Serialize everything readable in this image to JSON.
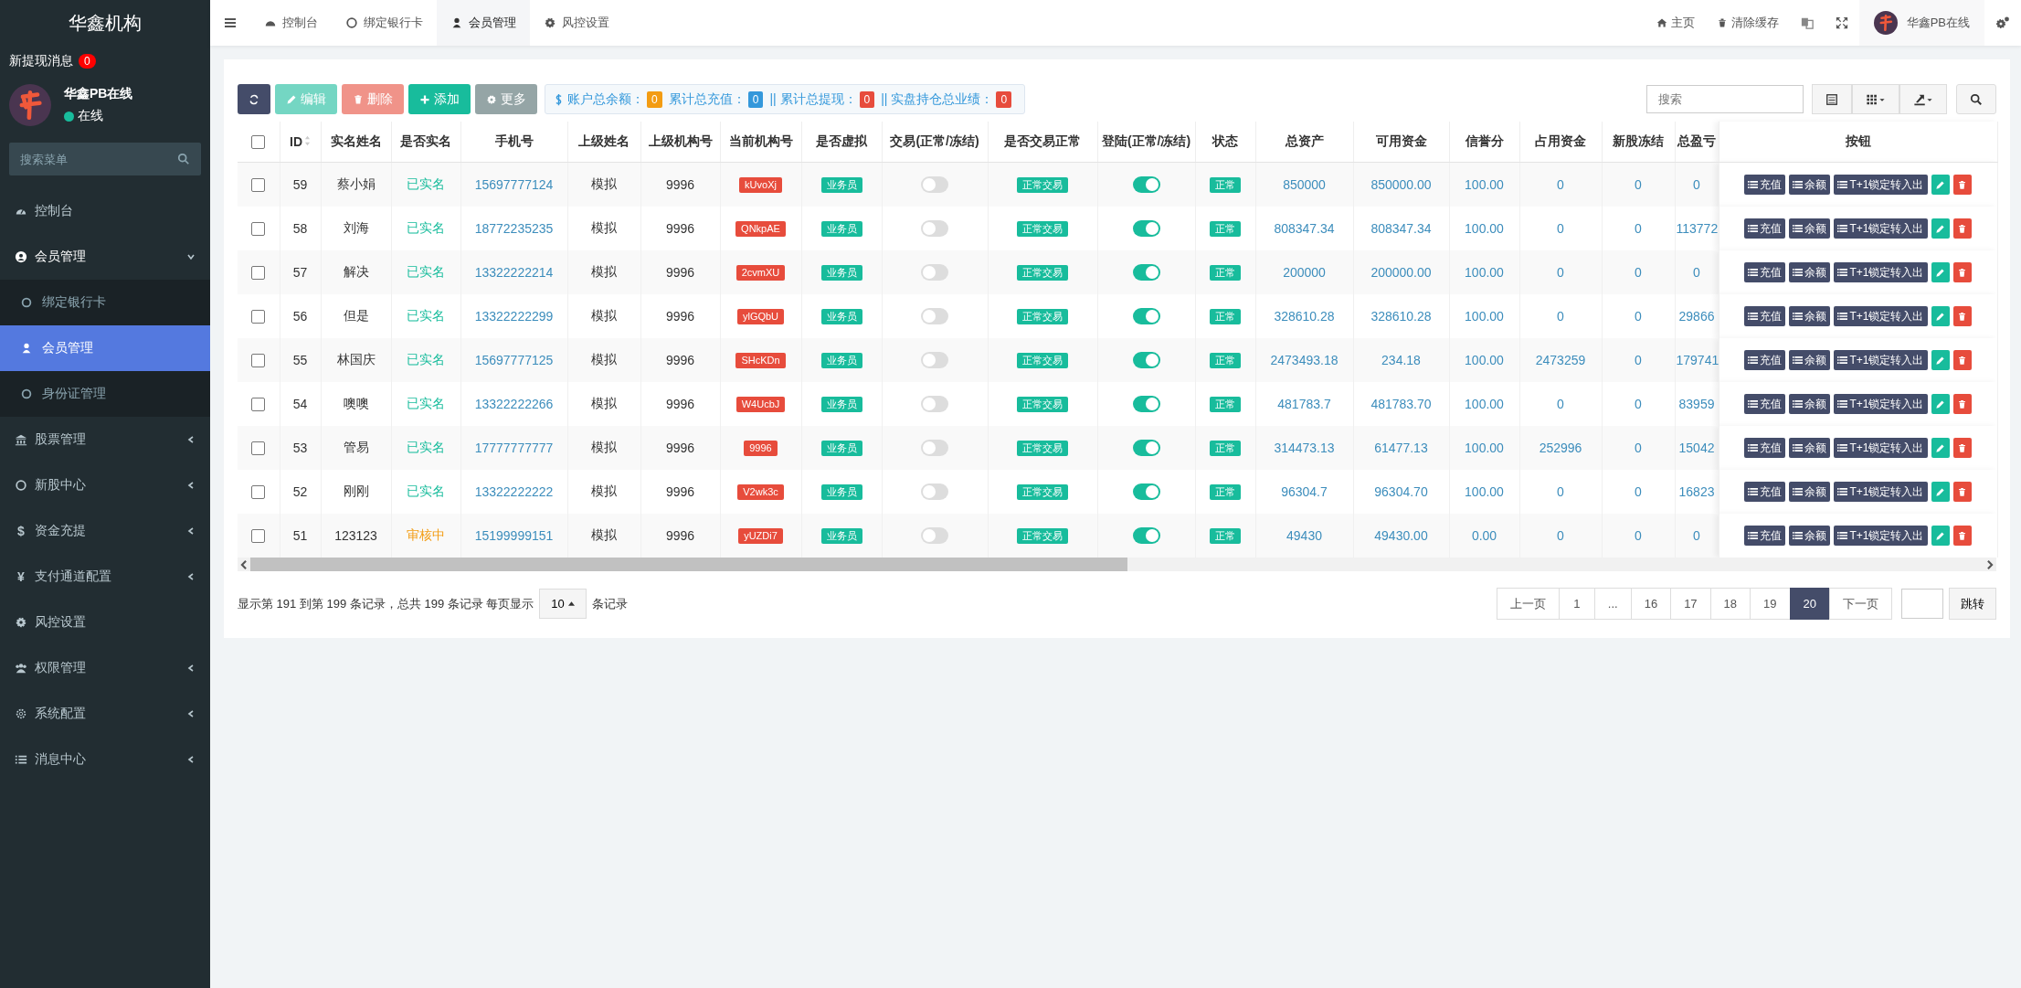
{
  "sidebar": {
    "brand": "华鑫机构",
    "notice": {
      "label": "新提现消息",
      "count": "0"
    },
    "user": {
      "name": "华鑫PB在线",
      "status": "在线",
      "online": true
    },
    "search": {
      "placeholder": "搜索菜单"
    },
    "items": [
      {
        "label": "控制台",
        "selected": false
      },
      {
        "label": "会员管理",
        "selected": false,
        "expanded": true,
        "children": [
          {
            "label": "绑定银行卡",
            "selected": false
          },
          {
            "label": "会员管理",
            "selected": true
          },
          {
            "label": "身份证管理",
            "selected": false
          }
        ]
      },
      {
        "label": "股票管理",
        "selected": false,
        "expanded": false
      },
      {
        "label": "新股中心",
        "selected": false,
        "expanded": false
      },
      {
        "label": "资金充提",
        "selected": false,
        "expanded": false,
        "glyph": "$"
      },
      {
        "label": "支付通道配置",
        "selected": false,
        "expanded": false,
        "glyph": "¥"
      },
      {
        "label": "风控设置",
        "selected": false
      },
      {
        "label": "权限管理",
        "selected": false,
        "expanded": false
      },
      {
        "label": "系统配置",
        "selected": false,
        "expanded": false
      },
      {
        "label": "消息中心",
        "selected": false,
        "expanded": false
      }
    ]
  },
  "topbar": {
    "tabs": [
      {
        "label": "控制台",
        "selected": false
      },
      {
        "label": "绑定银行卡",
        "selected": false
      },
      {
        "label": "会员管理",
        "selected": true
      },
      {
        "label": "风控设置",
        "selected": false
      }
    ],
    "links": [
      "主页",
      "清除缓存"
    ],
    "user": "华鑫PB在线"
  },
  "toolbar": {
    "buttons": [
      {
        "kind": "refresh",
        "disabled": false
      },
      {
        "kind": "edit",
        "label": "编辑",
        "disabled": true
      },
      {
        "kind": "delete",
        "label": "删除",
        "disabled": true
      },
      {
        "kind": "add",
        "label": "添加",
        "disabled": false
      },
      {
        "kind": "more",
        "label": "更多",
        "disabled": false
      }
    ],
    "stats": [
      {
        "label": "账户总余额：",
        "value": "0",
        "color": "#f39c12"
      },
      {
        "label": "累计总充值：",
        "value": "0",
        "color": "#3498db"
      },
      {
        "label": "|| 累计总提现：",
        "value": "0",
        "color": "#e74c3c"
      },
      {
        "label": "|| 实盘持仓总业绩：",
        "value": "0",
        "color": "#e74c3c"
      }
    ],
    "search": {
      "placeholder": "搜索"
    }
  },
  "table": {
    "select_all": false,
    "columns": [
      "ID",
      "实名姓名",
      "是否实名",
      "手机号",
      "上级姓名",
      "上级机构号",
      "当前机构号",
      "是否虚拟",
      "交易(正常/冻结)",
      "是否交易正常",
      "登陆(正常/冻结)",
      "状态",
      "总资产",
      "可用资金",
      "信誉分",
      "占用资金",
      "新股冻结",
      "总盈亏",
      "按钮"
    ],
    "rows": [
      {
        "checked": false,
        "id": "59",
        "name": "蔡小娟",
        "verify": {
          "text": "已实名",
          "kind": "done"
        },
        "phone": "15697777124",
        "parent": "模拟",
        "parent_org": "9996",
        "org": "kUvoXj",
        "virtual": "业务员",
        "trade_on": false,
        "trade_status": "正常交易",
        "login_on": true,
        "state": "正常",
        "total": "850000",
        "available": "850000.00",
        "credit": "100.00",
        "occupied": "0",
        "ipo_frozen": "0",
        "pnl": "0",
        "actions": [
          "充值",
          "余额",
          "T+1锁定转入出"
        ]
      },
      {
        "checked": false,
        "id": "58",
        "name": "刘海",
        "verify": {
          "text": "已实名",
          "kind": "done"
        },
        "phone": "18772235235",
        "parent": "模拟",
        "parent_org": "9996",
        "org": "QNkpAE",
        "virtual": "业务员",
        "trade_on": false,
        "trade_status": "正常交易",
        "login_on": true,
        "state": "正常",
        "total": "808347.34",
        "available": "808347.34",
        "credit": "100.00",
        "occupied": "0",
        "ipo_frozen": "0",
        "pnl": "113772",
        "actions": [
          "充值",
          "余额",
          "T+1锁定转入出"
        ]
      },
      {
        "checked": false,
        "id": "57",
        "name": "解决",
        "verify": {
          "text": "已实名",
          "kind": "done"
        },
        "phone": "13322222214",
        "parent": "模拟",
        "parent_org": "9996",
        "org": "2cvmXU",
        "virtual": "业务员",
        "trade_on": false,
        "trade_status": "正常交易",
        "login_on": true,
        "state": "正常",
        "total": "200000",
        "available": "200000.00",
        "credit": "100.00",
        "occupied": "0",
        "ipo_frozen": "0",
        "pnl": "0",
        "actions": [
          "充值",
          "余额",
          "T+1锁定转入出"
        ]
      },
      {
        "checked": false,
        "id": "56",
        "name": "但是",
        "verify": {
          "text": "已实名",
          "kind": "done"
        },
        "phone": "13322222299",
        "parent": "模拟",
        "parent_org": "9996",
        "org": "ylGQbU",
        "virtual": "业务员",
        "trade_on": false,
        "trade_status": "正常交易",
        "login_on": true,
        "state": "正常",
        "total": "328610.28",
        "available": "328610.28",
        "credit": "100.00",
        "occupied": "0",
        "ipo_frozen": "0",
        "pnl": "29866",
        "actions": [
          "充值",
          "余额",
          "T+1锁定转入出"
        ]
      },
      {
        "checked": false,
        "id": "55",
        "name": "林国庆",
        "verify": {
          "text": "已实名",
          "kind": "done"
        },
        "phone": "15697777125",
        "parent": "模拟",
        "parent_org": "9996",
        "org": "SHcKDn",
        "virtual": "业务员",
        "trade_on": false,
        "trade_status": "正常交易",
        "login_on": true,
        "state": "正常",
        "total": "2473493.18",
        "available": "234.18",
        "credit": "100.00",
        "occupied": "2473259",
        "ipo_frozen": "0",
        "pnl": "179741",
        "actions": [
          "充值",
          "余额",
          "T+1锁定转入出"
        ]
      },
      {
        "checked": false,
        "id": "54",
        "name": "噢噢",
        "verify": {
          "text": "已实名",
          "kind": "done"
        },
        "phone": "13322222266",
        "parent": "模拟",
        "parent_org": "9996",
        "org": "W4UcbJ",
        "virtual": "业务员",
        "trade_on": false,
        "trade_status": "正常交易",
        "login_on": true,
        "state": "正常",
        "total": "481783.7",
        "available": "481783.70",
        "credit": "100.00",
        "occupied": "0",
        "ipo_frozen": "0",
        "pnl": "83959",
        "actions": [
          "充值",
          "余额",
          "T+1锁定转入出"
        ]
      },
      {
        "checked": false,
        "id": "53",
        "name": "管易",
        "verify": {
          "text": "已实名",
          "kind": "done"
        },
        "phone": "17777777777",
        "parent": "模拟",
        "parent_org": "9996",
        "org": "9996",
        "virtual": "业务员",
        "trade_on": false,
        "trade_status": "正常交易",
        "login_on": true,
        "state": "正常",
        "total": "314473.13",
        "available": "61477.13",
        "credit": "100.00",
        "occupied": "252996",
        "ipo_frozen": "0",
        "pnl": "15042",
        "actions": [
          "充值",
          "余额",
          "T+1锁定转入出"
        ]
      },
      {
        "checked": false,
        "id": "52",
        "name": "刚刚",
        "verify": {
          "text": "已实名",
          "kind": "done"
        },
        "phone": "13322222222",
        "parent": "模拟",
        "parent_org": "9996",
        "org": "V2wk3c",
        "virtual": "业务员",
        "trade_on": false,
        "trade_status": "正常交易",
        "login_on": true,
        "state": "正常",
        "total": "96304.7",
        "available": "96304.70",
        "credit": "100.00",
        "occupied": "0",
        "ipo_frozen": "0",
        "pnl": "16823",
        "actions": [
          "充值",
          "余额",
          "T+1锁定转入出"
        ]
      },
      {
        "checked": false,
        "id": "51",
        "name": "123123",
        "verify": {
          "text": "审核中",
          "kind": "pending"
        },
        "phone": "15199999151",
        "parent": "模拟",
        "parent_org": "9996",
        "org": "yUZDi7",
        "virtual": "业务员",
        "trade_on": false,
        "trade_status": "正常交易",
        "login_on": true,
        "state": "正常",
        "total": "49430",
        "available": "49430.00",
        "credit": "0.00",
        "occupied": "0",
        "ipo_frozen": "0",
        "pnl": "0",
        "actions": [
          "充值",
          "余额",
          "T+1锁定转入出"
        ]
      }
    ]
  },
  "pagination": {
    "info": "显示第 191 到第 199 条记录，总共 199 条记录 每页显示",
    "page_size": "10",
    "suffix": "条记录",
    "pages": [
      {
        "label": "上一页",
        "selected": false
      },
      {
        "label": "1",
        "selected": false
      },
      {
        "label": "...",
        "selected": false
      },
      {
        "label": "16",
        "selected": false
      },
      {
        "label": "17",
        "selected": false
      },
      {
        "label": "18",
        "selected": false
      },
      {
        "label": "19",
        "selected": false
      },
      {
        "label": "20",
        "selected": true
      },
      {
        "label": "下一页",
        "selected": false
      }
    ],
    "jump": "跳转"
  }
}
